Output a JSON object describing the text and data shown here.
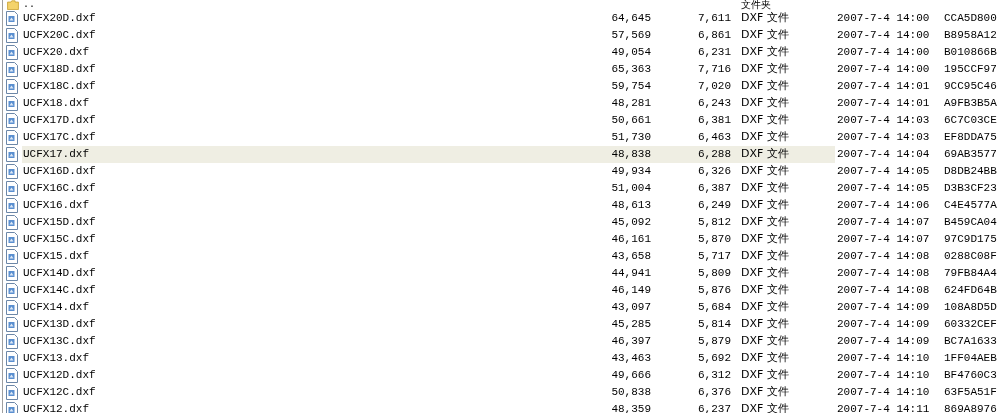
{
  "parent_row": {
    "name": "..",
    "type": "文件夹"
  },
  "files": [
    {
      "name": "UCFX20D.dxf",
      "size": "64,645",
      "packed": "7,611",
      "type": "DXF 文件",
      "modified": "2007-7-4 14:00",
      "crc": "CCA5D800",
      "selected": false
    },
    {
      "name": "UCFX20C.dxf",
      "size": "57,569",
      "packed": "6,861",
      "type": "DXF 文件",
      "modified": "2007-7-4 14:00",
      "crc": "B8958A12",
      "selected": false
    },
    {
      "name": "UCFX20.dxf",
      "size": "49,054",
      "packed": "6,231",
      "type": "DXF 文件",
      "modified": "2007-7-4 14:00",
      "crc": "B010866B",
      "selected": false
    },
    {
      "name": "UCFX18D.dxf",
      "size": "65,363",
      "packed": "7,716",
      "type": "DXF 文件",
      "modified": "2007-7-4 14:00",
      "crc": "195CCF97",
      "selected": false
    },
    {
      "name": "UCFX18C.dxf",
      "size": "59,754",
      "packed": "7,020",
      "type": "DXF 文件",
      "modified": "2007-7-4 14:01",
      "crc": "9CC95C46",
      "selected": false
    },
    {
      "name": "UCFX18.dxf",
      "size": "48,281",
      "packed": "6,243",
      "type": "DXF 文件",
      "modified": "2007-7-4 14:01",
      "crc": "A9FB3B5A",
      "selected": false
    },
    {
      "name": "UCFX17D.dxf",
      "size": "50,661",
      "packed": "6,381",
      "type": "DXF 文件",
      "modified": "2007-7-4 14:03",
      "crc": "6C7C03CE",
      "selected": false
    },
    {
      "name": "UCFX17C.dxf",
      "size": "51,730",
      "packed": "6,463",
      "type": "DXF 文件",
      "modified": "2007-7-4 14:03",
      "crc": "EF8DDA75",
      "selected": false
    },
    {
      "name": "UCFX17.dxf",
      "size": "48,838",
      "packed": "6,288",
      "type": "DXF 文件",
      "modified": "2007-7-4 14:04",
      "crc": "69AB3577",
      "selected": true
    },
    {
      "name": "UCFX16D.dxf",
      "size": "49,934",
      "packed": "6,326",
      "type": "DXF 文件",
      "modified": "2007-7-4 14:05",
      "crc": "D8DB24BB",
      "selected": false
    },
    {
      "name": "UCFX16C.dxf",
      "size": "51,004",
      "packed": "6,387",
      "type": "DXF 文件",
      "modified": "2007-7-4 14:05",
      "crc": "D3B3CF23",
      "selected": false
    },
    {
      "name": "UCFX16.dxf",
      "size": "48,613",
      "packed": "6,249",
      "type": "DXF 文件",
      "modified": "2007-7-4 14:06",
      "crc": "C4E4577A",
      "selected": false
    },
    {
      "name": "UCFX15D.dxf",
      "size": "45,092",
      "packed": "5,812",
      "type": "DXF 文件",
      "modified": "2007-7-4 14:07",
      "crc": "B459CA04",
      "selected": false
    },
    {
      "name": "UCFX15C.dxf",
      "size": "46,161",
      "packed": "5,870",
      "type": "DXF 文件",
      "modified": "2007-7-4 14:07",
      "crc": "97C9D175",
      "selected": false
    },
    {
      "name": "UCFX15.dxf",
      "size": "43,658",
      "packed": "5,717",
      "type": "DXF 文件",
      "modified": "2007-7-4 14:08",
      "crc": "0288C08F",
      "selected": false
    },
    {
      "name": "UCFX14D.dxf",
      "size": "44,941",
      "packed": "5,809",
      "type": "DXF 文件",
      "modified": "2007-7-4 14:08",
      "crc": "79FB84A4",
      "selected": false
    },
    {
      "name": "UCFX14C.dxf",
      "size": "46,149",
      "packed": "5,876",
      "type": "DXF 文件",
      "modified": "2007-7-4 14:08",
      "crc": "624FD64B",
      "selected": false
    },
    {
      "name": "UCFX14.dxf",
      "size": "43,097",
      "packed": "5,684",
      "type": "DXF 文件",
      "modified": "2007-7-4 14:09",
      "crc": "108A8D5D",
      "selected": false
    },
    {
      "name": "UCFX13D.dxf",
      "size": "45,285",
      "packed": "5,814",
      "type": "DXF 文件",
      "modified": "2007-7-4 14:09",
      "crc": "60332CEF",
      "selected": false
    },
    {
      "name": "UCFX13C.dxf",
      "size": "46,397",
      "packed": "5,879",
      "type": "DXF 文件",
      "modified": "2007-7-4 14:09",
      "crc": "BC7A1633",
      "selected": false
    },
    {
      "name": "UCFX13.dxf",
      "size": "43,463",
      "packed": "5,692",
      "type": "DXF 文件",
      "modified": "2007-7-4 14:10",
      "crc": "1FF04AEB",
      "selected": false
    },
    {
      "name": "UCFX12D.dxf",
      "size": "49,666",
      "packed": "6,312",
      "type": "DXF 文件",
      "modified": "2007-7-4 14:10",
      "crc": "BF4760C3",
      "selected": false
    },
    {
      "name": "UCFX12C.dxf",
      "size": "50,838",
      "packed": "6,376",
      "type": "DXF 文件",
      "modified": "2007-7-4 14:10",
      "crc": "63F5A51F",
      "selected": false
    },
    {
      "name": "UCFX12.dxf",
      "size": "48,359",
      "packed": "6,237",
      "type": "DXF 文件",
      "modified": "2007-7-4 14:11",
      "crc": "869A8976",
      "selected": false
    }
  ]
}
